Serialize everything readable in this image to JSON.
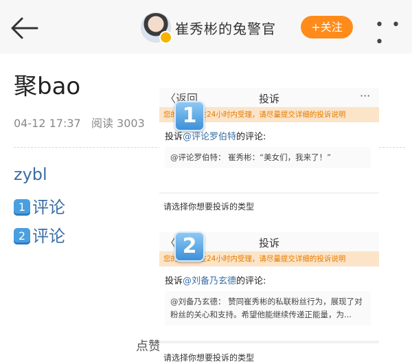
{
  "header": {
    "username": "崔秀彬的兔警官",
    "follow_label": "+关注",
    "more_glyph": "• • •",
    "back_icon": "arrow-left-icon",
    "verified_color": "#f5b400",
    "follow_color": "#ff8c1a"
  },
  "post": {
    "title": "聚bao",
    "date": "04-12 17:37",
    "reads": "阅读 3003",
    "line1": "zybl",
    "line2_key": "1",
    "line2_text": "评论",
    "line3_key": "2",
    "line3_text": "评论",
    "likes_partial": "点赞"
  },
  "screenshots": [
    {
      "badge": "1",
      "back_label": "〈返回",
      "title": "投诉",
      "more": "···",
      "notice": "您的投诉将在24小时内受理，请尽量提交详细的投诉说明",
      "target_prefix": "投诉",
      "target_user": "@评论罗伯特",
      "target_suffix": "的评论:",
      "quote": "@评论罗伯特：  崔秀彬：“美女们，我来了！”",
      "type_prompt": "请选择你想要投诉的类型"
    },
    {
      "badge": "2",
      "back_label": "〈",
      "title": "投诉",
      "notice": "您的投诉将在24小时内受理，请尽量提交详细的投诉说明",
      "target_prefix": "投诉",
      "target_user": "@刘备乃玄德",
      "target_suffix": "的评论:",
      "quote": "@刘备乃玄德：  赞同崔秀彬的私联粉丝行为，展现了对粉丝的关心和支持。希望他能继续传递正能量，为...",
      "type_prompt": "请选择你想要投诉的类型"
    }
  ]
}
